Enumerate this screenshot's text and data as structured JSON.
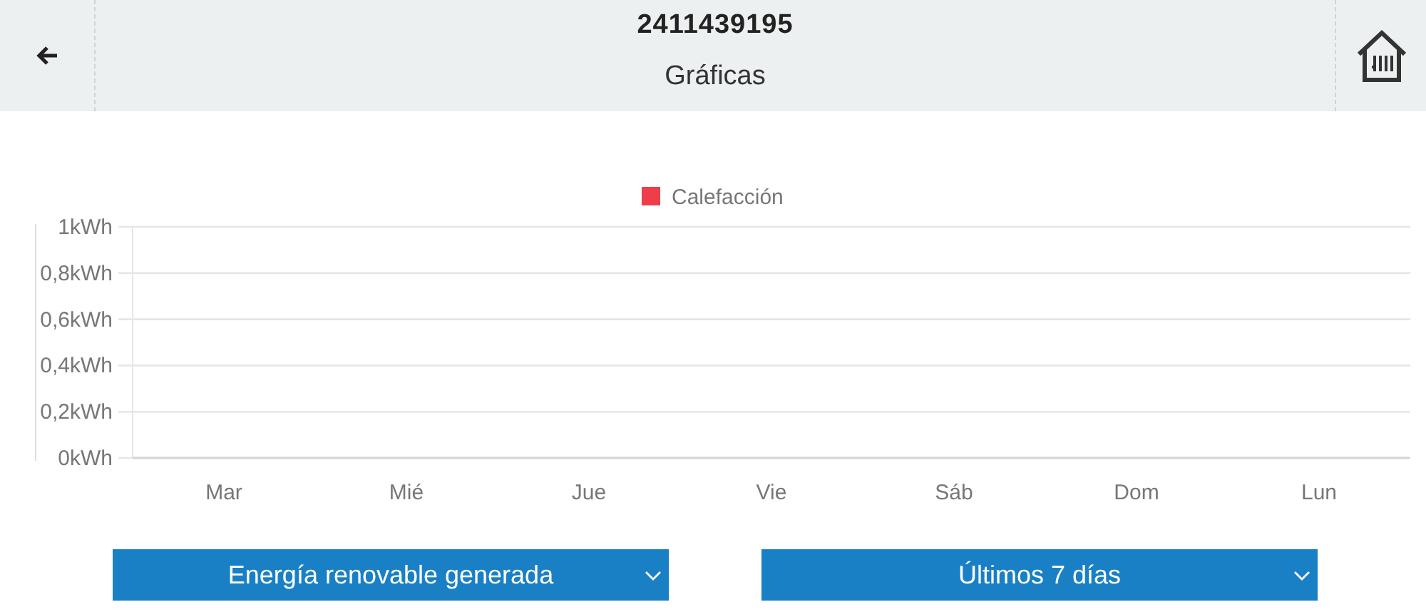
{
  "header": {
    "title": "2411439195",
    "subtitle": "Gráficas"
  },
  "chart": {
    "chart_data": {
      "type": "bar",
      "categories": [
        "Mar",
        "Mié",
        "Jue",
        "Vie",
        "Sáb",
        "Dom",
        "Lun"
      ],
      "series": [
        {
          "name": "Calefacción",
          "color": "#ef3e4a",
          "values": [
            0,
            0,
            0,
            0,
            0,
            0,
            0
          ]
        }
      ],
      "ylim": [
        0,
        1
      ],
      "grid": true,
      "yticks": [
        {
          "value": 0,
          "label": "0kWh"
        },
        {
          "value": 0.2,
          "label": "0,2kWh"
        },
        {
          "value": 0.4,
          "label": "0,4kWh"
        },
        {
          "value": 0.6,
          "label": "0,6kWh"
        },
        {
          "value": 0.8,
          "label": "0,8kWh"
        },
        {
          "value": 1,
          "label": "1kWh"
        }
      ]
    }
  },
  "dropdowns": [
    {
      "value": "Energía renovable generada"
    },
    {
      "value": "Últimos 7 días"
    }
  ]
}
